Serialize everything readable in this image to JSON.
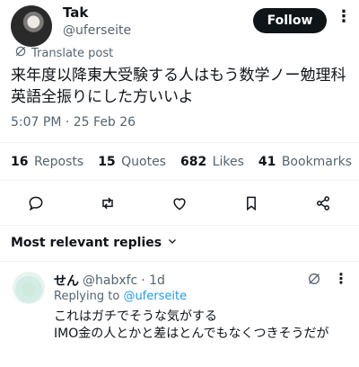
{
  "author": {
    "name": "Tak",
    "handle": "@uferseite"
  },
  "follow_label": "Follow",
  "translate_label": "Translate post",
  "tweet_text": "来年度以降東大受験する人はもう数学ノー勉理科英語全振りにした方いいよ",
  "timestamp": "5:07 PM · 25 Feb 26",
  "stats": {
    "reposts_count": "16",
    "reposts_label": "Reposts",
    "quotes_count": "15",
    "quotes_label": "Quotes",
    "likes_count": "682",
    "likes_label": "Likes",
    "bookmarks_count": "41",
    "bookmarks_label": "Bookmarks"
  },
  "actions": [
    "reply-icon",
    "repost-icon",
    "like-icon",
    "bookmark-icon",
    "share-icon"
  ],
  "replies_header": "Most relevant replies",
  "reply": {
    "name": "せん",
    "handle": "@habxfc",
    "time": "· 1d",
    "replying_prefix": "Replying to",
    "replying_to": "@uferseite",
    "text_line1": "これはガチでそうな気がする",
    "text_line2": "IMO金の人とかと差はとんでもなくつきそうだが"
  },
  "colors": {
    "text": "#0f1419",
    "secondary": "#536471",
    "link": "#1d9bf0",
    "follow_bg": "#0f1419"
  }
}
